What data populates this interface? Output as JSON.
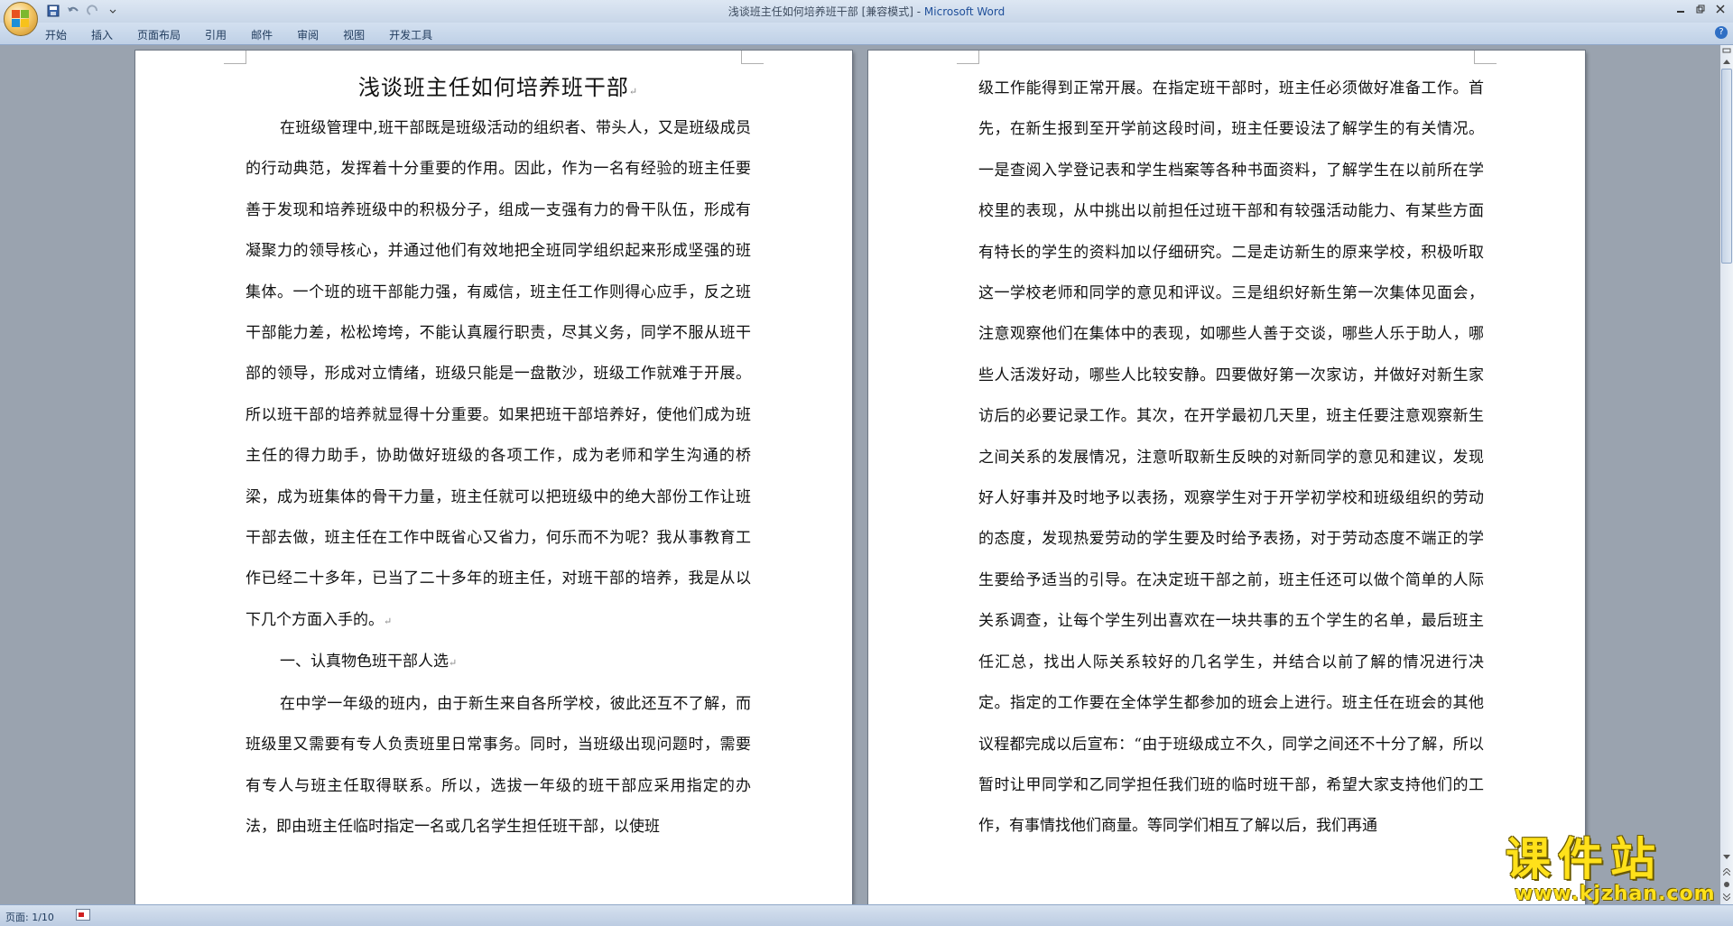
{
  "window": {
    "doc_title": "浅谈班主任如何培养班干部 [兼容模式] - ",
    "app_name": "Microsoft Word"
  },
  "ribbon": {
    "tabs": [
      "开始",
      "插入",
      "页面布局",
      "引用",
      "邮件",
      "审阅",
      "视图",
      "开发工具"
    ]
  },
  "left_page": {
    "title": "浅谈班主任如何培养班干部",
    "para1": "在班级管理中,班干部既是班级活动的组织者、带头人，又是班级成员的行动典范，发挥着十分重要的作用。因此，作为一名有经验的班主任要善于发现和培养班级中的积极分子，组成一支强有力的骨干队伍，形成有凝聚力的领导核心，并通过他们有效地把全班同学组织起来形成坚强的班集体。一个班的班干部能力强，有威信，班主任工作则得心应手，反之班干部能力差，松松垮垮，不能认真履行职责，尽其义务，同学不服从班干部的领导，形成对立情绪，班级只能是一盘散沙，班级工作就难于开展。所以班干部的培养就显得十分重要。如果把班干部培养好，使他们成为班主任的得力助手，协助做好班级的各项工作，成为老师和学生沟通的桥梁，成为班集体的骨干力量，班主任就可以把班级中的绝大部份工作让班干部去做，班主任在工作中既省心又省力，何乐而不为呢？我从事教育工作已经二十多年，已当了二十多年的班主任，对班干部的培养，我是从以下几个方面入手的。",
    "heading1": "一、认真物色班干部人选",
    "para2": "在中学一年级的班内，由于新生来自各所学校，彼此还互不了解，而班级里又需要有专人负责班里日常事务。同时，当班级出现问题时，需要有专人与班主任取得联系。所以，选拔一年级的班干部应采用指定的办法，即由班主任临时指定一名或几名学生担任班干部，以使班"
  },
  "right_page": {
    "para1": "级工作能得到正常开展。在指定班干部时，班主任必须做好准备工作。首先，在新生报到至开学前这段时间，班主任要设法了解学生的有关情况。一是查阅入学登记表和学生档案等各种书面资料，了解学生在以前所在学校里的表现，从中挑出以前担任过班干部和有较强活动能力、有某些方面有特长的学生的资料加以仔细研究。二是走访新生的原来学校，积极听取这一学校老师和同学的意见和评议。三是组织好新生第一次集体见面会，注意观察他们在集体中的表现，如哪些人善于交谈，哪些人乐于助人，哪些人活泼好动，哪些人比较安静。四要做好第一次家访，并做好对新生家访后的必要记录工作。其次，在开学最初几天里，班主任要注意观察新生之间关系的发展情况，注意听取新生反映的对新同学的意见和建议，发现好人好事并及时地予以表扬，观察学生对于开学初学校和班级组织的劳动的态度，发现热爱劳动的学生要及时给予表扬，对于劳动态度不端正的学生要给予适当的引导。在决定班干部之前，班主任还可以做个简单的人际关系调查，让每个学生列出喜欢在一块共事的五个学生的名单，最后班主任汇总，找出人际关系较好的几名学生，并结合以前了解的情况进行决定。指定的工作要在全体学生都参加的班会上进行。班主任在班会的其他议程都完成以后宣布：“由于班级成立不久，同学之间还不十分了解，所以暂时让甲同学和乙同学担任我们班的临时班干部，希望大家支持他们的工作，有事情找他们商量。等同学们相互了解以后，我们再通"
  },
  "status": {
    "page_label": "页面: 1/10"
  },
  "watermark": {
    "cn": "课件站",
    "url": "www.kjzhan.com"
  },
  "colors": {
    "accent": "#1f4f9a",
    "watermark": "#ffe11a"
  }
}
